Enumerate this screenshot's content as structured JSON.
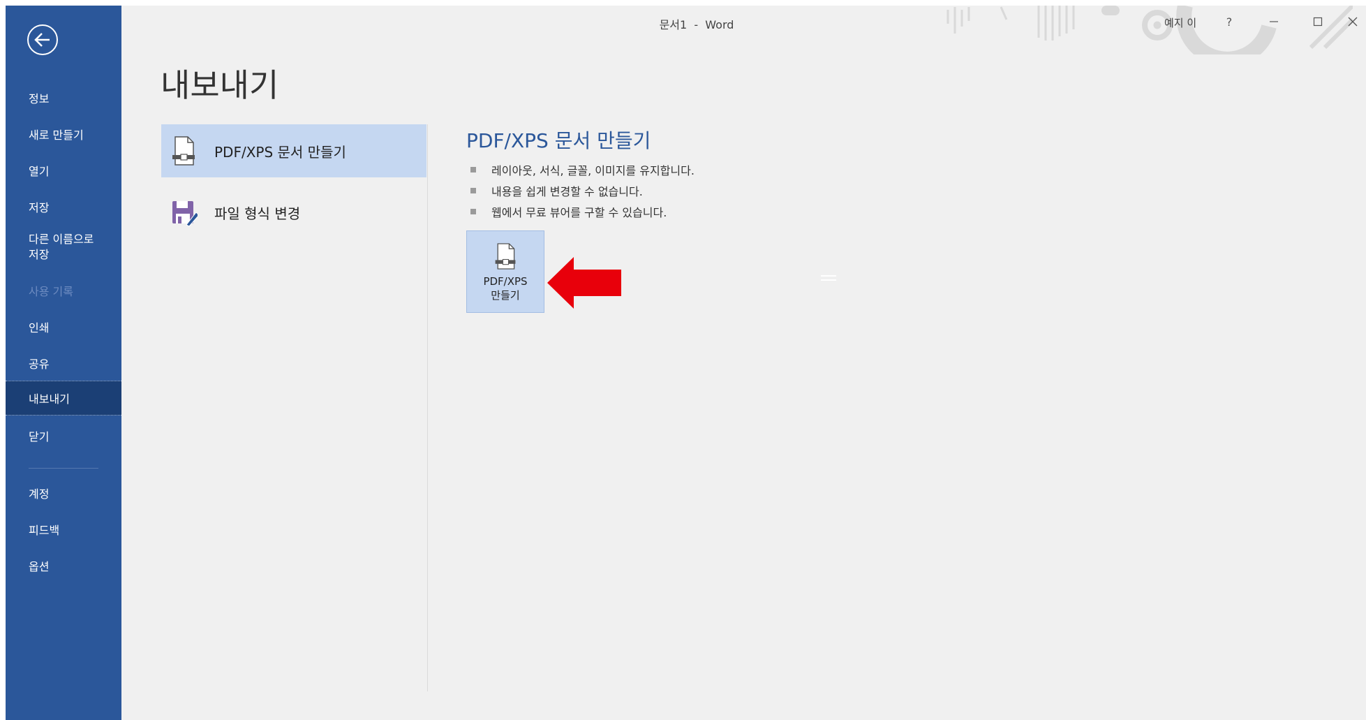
{
  "window": {
    "title": "문서1  -  Word",
    "user": "예지 이",
    "help_icon": "question-icon",
    "minimize_icon": "minimize-icon",
    "restore_icon": "restore-icon",
    "close_icon": "close-icon"
  },
  "sidebar": {
    "back_icon": "back-arrow-icon",
    "items": [
      {
        "label": "정보",
        "state": "normal"
      },
      {
        "label": "새로 만들기",
        "state": "normal"
      },
      {
        "label": "열기",
        "state": "normal"
      },
      {
        "label": "저장",
        "state": "normal"
      },
      {
        "label": "다른 이름으로\n저장",
        "state": "normal"
      },
      {
        "label": "사용 기록",
        "state": "disabled"
      },
      {
        "label": "인쇄",
        "state": "normal"
      },
      {
        "label": "공유",
        "state": "normal"
      },
      {
        "label": "내보내기",
        "state": "active"
      },
      {
        "label": "닫기",
        "state": "normal"
      },
      {
        "label": "계정",
        "state": "normal"
      },
      {
        "label": "피드백",
        "state": "normal"
      },
      {
        "label": "옵션",
        "state": "normal"
      }
    ]
  },
  "main": {
    "title": "내보내기",
    "options": [
      {
        "label": "PDF/XPS 문서 만들기",
        "icon": "pdf-document-icon",
        "selected": true
      },
      {
        "label": "파일 형식 변경",
        "icon": "save-as-format-icon",
        "selected": false
      }
    ],
    "detail": {
      "title": "PDF/XPS 문서 만들기",
      "bullets": [
        "레이아웃, 서식, 글꼴, 이미지를 유지합니다.",
        "내용을 쉽게 변경할 수 없습니다.",
        "웹에서 무료 뷰어를 구할 수 있습니다."
      ],
      "button_label": "PDF/XPS\n만들기",
      "button_icon": "pdf-document-icon"
    },
    "annotation_arrow_color": "#e8000b"
  },
  "colors": {
    "sidebar": "#2b579a",
    "sidebar_active": "#1b3f75",
    "accent_text": "#2b579a",
    "selected_bg": "#c5d7f1"
  }
}
